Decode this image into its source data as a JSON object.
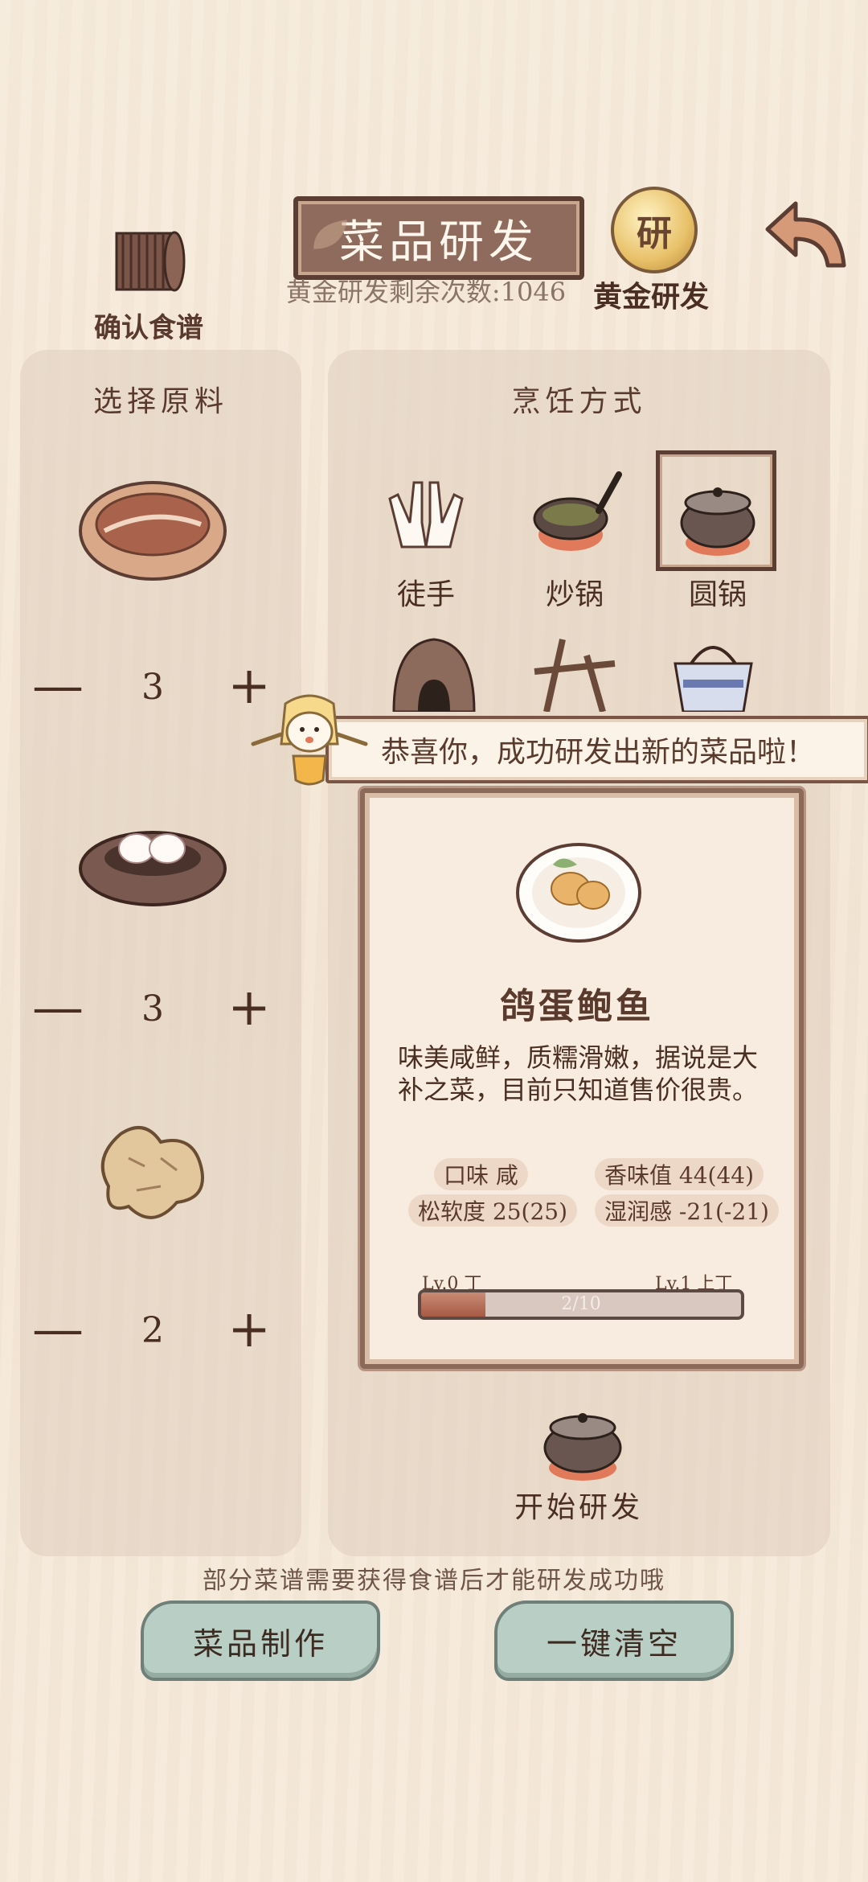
{
  "header": {
    "title": "菜品研发",
    "gold_remaining": "黄金研发剩余次数:1046",
    "recipe_label": "确认食谱",
    "gold_label": "黄金研发",
    "gold_coin_glyph": "研"
  },
  "ingredients": {
    "title": "选择原料",
    "items": [
      {
        "icon": "bread-icon",
        "qty": "3"
      },
      {
        "icon": "pigeon-eggs-nest-icon",
        "qty": "3"
      },
      {
        "icon": "ginger-icon",
        "qty": "2"
      }
    ],
    "minus": "—",
    "plus": "+"
  },
  "cooking": {
    "title": "烹饪方式",
    "methods": [
      {
        "label": "徒手",
        "icon": "hands-icon",
        "selected": false
      },
      {
        "label": "炒锅",
        "icon": "wok-icon",
        "selected": false
      },
      {
        "label": "圆锅",
        "icon": "round-pot-icon",
        "selected": true
      }
    ]
  },
  "toast": "恭喜你，成功研发出新的菜品啦！",
  "result": {
    "dish_name": "鸽蛋鲍鱼",
    "description": "味美咸鲜，质糯滑嫩，据说是大补之菜，目前只知道售价很贵。",
    "stats": [
      "口味 咸",
      "香味值 44(44)",
      "松软度 25(25)",
      "湿润感 -21(-21)"
    ],
    "level_left": "Lv.0 丁",
    "level_right": "Lv.1 上丁",
    "progress_text": "2/10",
    "progress": 0.2
  },
  "start_label": "开始研发",
  "hint": "部分菜谱需要获得食谱后才能研发成功哦",
  "buttons": {
    "make": "菜品制作",
    "clear": "一键清空"
  },
  "colors": {
    "accent_brown": "#5b3d33",
    "button_green": "#b9cfc6",
    "progress_fill": "#a65a44"
  }
}
